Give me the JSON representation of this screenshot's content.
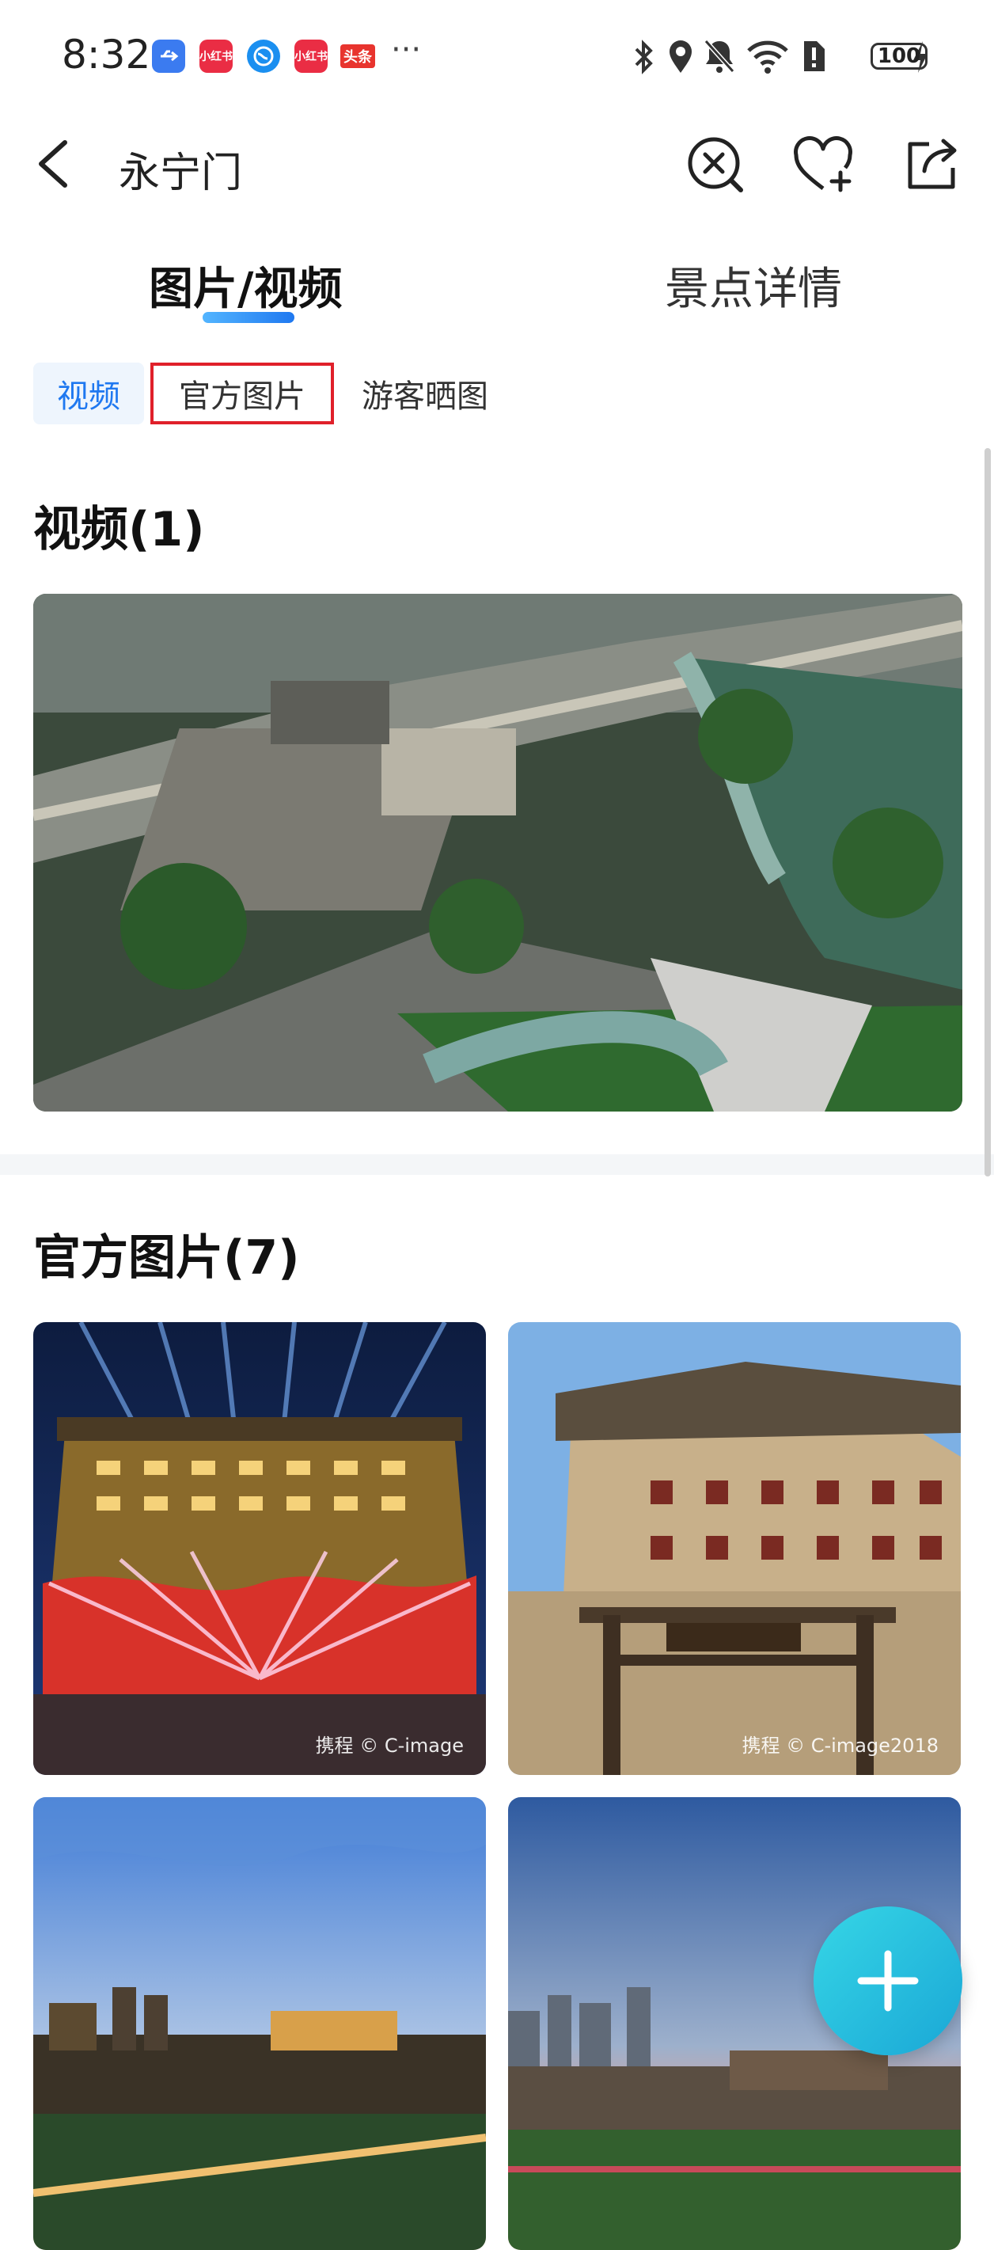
{
  "status_bar": {
    "time": "8:32",
    "app_badges": [
      {
        "label": "USB",
        "color": "#3b7bf0"
      },
      {
        "label": "小红书",
        "color": "#ea2d44"
      },
      {
        "label": "",
        "color": "#1b8ff0"
      },
      {
        "label": "小红书",
        "color": "#ea2d44"
      },
      {
        "label": "头条",
        "color": "#e8342e"
      }
    ],
    "overflow": "···",
    "battery": "100"
  },
  "header": {
    "title": "永宁门",
    "icons": [
      "back-icon",
      "close-circle-icon",
      "heart-add-icon",
      "share-icon"
    ]
  },
  "tabs": {
    "active": "图片/视频",
    "inactive": "景点详情"
  },
  "subtabs": {
    "video": "视频",
    "official": "官方图片",
    "tourist": "游客晒图"
  },
  "sections": {
    "video_title": "视频(1)",
    "official_title": "官方图片(7)"
  },
  "photos": [
    {
      "watermark": "携程 © C-image"
    },
    {
      "watermark": "携程 © C-image2018"
    },
    {
      "watermark": ""
    },
    {
      "watermark": ""
    }
  ],
  "colors": {
    "accent": "#1f78f0",
    "highlight_border": "#e0202a",
    "fab": "#1aa7d6"
  }
}
